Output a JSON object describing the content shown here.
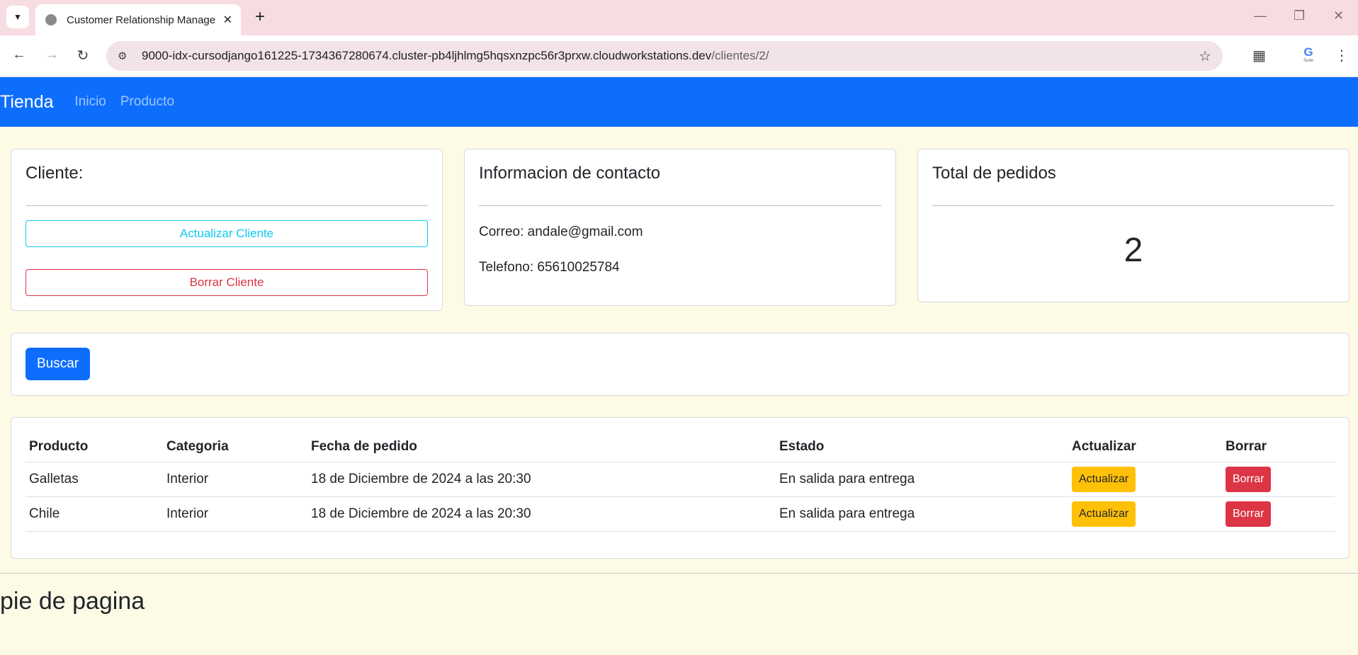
{
  "browser": {
    "tab_title": "Customer Relationship Manage",
    "url_host": "9000-idx-cursodjango161225-1734367280674.cluster-pb4ljhlmg5hqsxnzpc56r3prxw.cloudworkstations.dev",
    "url_path": "/clientes/2/",
    "badge_letter": "G",
    "badge_text": "Suite"
  },
  "nav": {
    "brand": "Tienda",
    "links": [
      "Inicio",
      "Producto"
    ]
  },
  "cliente_card": {
    "title": "Cliente:",
    "update_label": "Actualizar Cliente",
    "delete_label": "Borrar Cliente"
  },
  "contact_card": {
    "title": "Informacion de contacto",
    "email": "Correo: andale@gmail.com",
    "phone": "Telefono: 65610025784"
  },
  "orders_card": {
    "title": "Total de pedidos",
    "total": "2"
  },
  "search": {
    "button_label": "Buscar"
  },
  "orders_table": {
    "headers": [
      "Producto",
      "Categoria",
      "Fecha de pedido",
      "Estado",
      "Actualizar",
      "Borrar"
    ],
    "rows": [
      {
        "producto": "Galletas",
        "categoria": "Interior",
        "fecha": "18 de Diciembre de 2024 a las 20:30",
        "estado": "En salida para entrega",
        "actualizar": "Actualizar",
        "borrar": "Borrar"
      },
      {
        "producto": "Chile",
        "categoria": "Interior",
        "fecha": "18 de Diciembre de 2024 a las 20:30",
        "estado": "En salida para entrega",
        "actualizar": "Actualizar",
        "borrar": "Borrar"
      }
    ]
  },
  "footer": {
    "title": "pie de pagina"
  },
  "colors": {
    "primary": "#0d6efd",
    "info": "#0dcaf0",
    "danger": "#dc3545",
    "warning": "#ffc107",
    "page_bg": "#fdfbe6"
  }
}
